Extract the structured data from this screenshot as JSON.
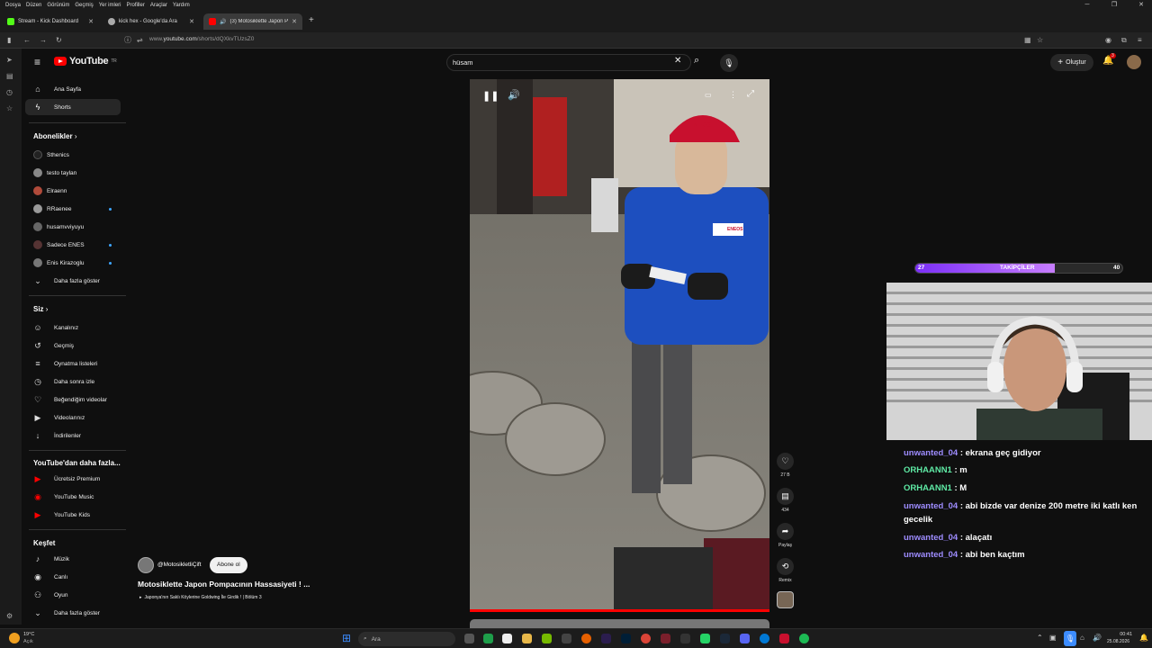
{
  "os_menu": [
    "Dosya",
    "Düzen",
    "Görünüm",
    "Geçmiş",
    "Yer imleri",
    "Profiller",
    "Araçlar",
    "Yardım"
  ],
  "tabs": [
    {
      "title": "Stream - Kick Dashboard",
      "color": "#53fc18"
    },
    {
      "title": "kick hex - Google'da Ara",
      "color": "#aaaaaa"
    },
    {
      "title": "(3) Motosiklette Japon Pom",
      "color": "#ff0000"
    }
  ],
  "address": {
    "prefix": "www.",
    "host": "youtube.com",
    "path": "/shorts/dQXkvTUzsZ0"
  },
  "youtube": {
    "logo_text": "YouTube",
    "logo_sup": "TR",
    "search_value": "hüsam",
    "create_label": "Oluştur",
    "notif_count": "3"
  },
  "sidebar": {
    "main": [
      {
        "label": "Ana Sayfa",
        "icon": "home-icon"
      },
      {
        "label": "Shorts",
        "icon": "shorts-icon",
        "active": true
      }
    ],
    "subs_title": "Abonelikler",
    "subs": [
      {
        "label": "Sthenics",
        "color": "#222222",
        "dot": false
      },
      {
        "label": "testo taylan",
        "color": "#888888",
        "dot": false
      },
      {
        "label": "Elraenn",
        "color": "#b04a3a",
        "dot": false
      },
      {
        "label": "RRaenee",
        "color": "#999999",
        "dot": true
      },
      {
        "label": "husamvviyuyu",
        "color": "#666666",
        "dot": false
      },
      {
        "label": "Sadece ENES",
        "color": "#553333",
        "dot": true
      },
      {
        "label": "Enis Kirazoglu",
        "color": "#777777",
        "dot": true
      }
    ],
    "more_label": "Daha fazla göster",
    "you_title": "Siz",
    "you": [
      {
        "label": "Kanalınız",
        "icon": "person-box-icon",
        "glyph": "☺"
      },
      {
        "label": "Geçmiş",
        "icon": "history-icon",
        "glyph": "↺"
      },
      {
        "label": "Oynatma listeleri",
        "icon": "playlist-icon",
        "glyph": "≡"
      },
      {
        "label": "Daha sonra izle",
        "icon": "clock-icon",
        "glyph": "◷"
      },
      {
        "label": "Beğendiğim videolar",
        "icon": "thumb-up-icon",
        "glyph": "♡"
      },
      {
        "label": "Videolarınız",
        "icon": "video-icon",
        "glyph": "▶"
      },
      {
        "label": "İndirilenler",
        "icon": "download-icon",
        "glyph": "↓"
      }
    ],
    "yt_more_title": "YouTube'dan daha fazla...",
    "yt_more": [
      {
        "label": "Ücretsiz Premium"
      },
      {
        "label": "YouTube Music"
      },
      {
        "label": "YouTube Kids"
      }
    ],
    "explore_title": "Keşfet",
    "explore": [
      {
        "label": "Müzik",
        "icon": "music-icon",
        "glyph": "♪"
      },
      {
        "label": "Canlı",
        "icon": "live-icon",
        "glyph": "◉"
      },
      {
        "label": "Oyun",
        "icon": "gamepad-icon",
        "glyph": "⚇"
      }
    ],
    "explore_more": "Daha fazla göster"
  },
  "short": {
    "channel": "@MotosikletliÇift",
    "subscribe_label": "Abone ol",
    "title": "Motosiklette Japon Pompacının Hassasiyeti ! ...",
    "playlist": "Japonya'nın Saklı Köylerine Goldwing İle Girdik ! | Bölüm 3",
    "likes": "27 B",
    "comments": "434",
    "share_label": "Paylaş",
    "remix_label": "Remix",
    "shirt_text": "ENEOS"
  },
  "overlay": {
    "followers_label": "TAKİPÇİLER",
    "followers_current": "27",
    "followers_goal": "40",
    "followers_fraction": 0.675
  },
  "chat": [
    {
      "user": "unwanted_04",
      "msg": ": ekrana geç gidiyor",
      "style": "u"
    },
    {
      "user": "ORHAANN1",
      "msg": ": m",
      "style": "u2"
    },
    {
      "user": "ORHAANN1",
      "msg": ": M",
      "style": "u2"
    },
    {
      "user": "unwanted_04",
      "msg": ": abi bizde var denize 200 metre iki katlı ken",
      "msg2": "gecelik",
      "style": "u"
    },
    {
      "user": "unwanted_04",
      "msg": ": alaçatı",
      "style": "u"
    },
    {
      "user": "unwanted_04",
      "msg": ": abi ben kaçtım",
      "style": "u"
    }
  ],
  "taskbar": {
    "weather_temp": "19°C",
    "weather_text": "Açık",
    "search_placeholder": "Ara",
    "time": "00:41",
    "date": "25.08.2026"
  }
}
